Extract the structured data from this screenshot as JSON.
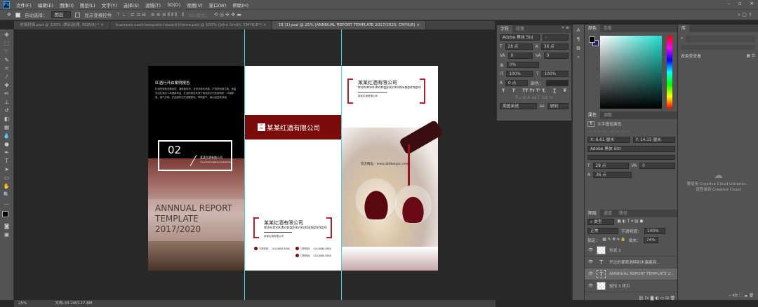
{
  "menu": [
    "文件(F)",
    "编辑(E)",
    "图像(I)",
    "图层(L)",
    "文字(Y)",
    "选择(S)",
    "滤镜(T)",
    "3D(D)",
    "视图(V)",
    "窗口(W)",
    "帮助(H)"
  ],
  "options": {
    "auto_select": "自动选择：",
    "layer_select": "图层",
    "show_transform": "显示变换控件",
    "mode_3d": "3D 模式："
  },
  "tabs": [
    "老猫封面.psd @ 100% (数码处理, RGB/8) *",
    "business-card-template-hazard-theme.psd @ 100% (John Smith, CMYK/8*)",
    "18 (1).psd @ 25% (ANNNUAL  REPORT TEMPLATE 2017/2020, CMYK/8)"
  ],
  "doc": {
    "p1_heading": "红酒行开启案例报告",
    "p1_body": "红酒是葡萄发酵而成，酒精度较低，含有多种有机酸、矿物质和维生素。适量饮用红酒对人体健康有益。红酒的颜色来源于葡萄皮中的色素物质，口感醇厚，香气浓郁。在品酒时应先观察颜色，再闻香气，最后品尝其味道。",
    "p1_number": "02",
    "p1_box_small": "某某红酒有限公司",
    "p1_box_pinyin": "moumouhongjiuyouxiangongsi",
    "p1_title": "ANNNUAL  REPORT TEMPLATE 2017/2020",
    "logo_top": "LO",
    "logo_bottom": "GO",
    "company": "某某红酒有限公司",
    "pinyin": "moumouhongjiuyouxiangongsi",
    "company_small": "某某红酒有限公司",
    "hotline_label": "订购热线：",
    "hotlines": [
      "020-8888 8888",
      "020-8888 8888",
      "020-8888 8888"
    ],
    "website": "官方网址：www.dbfheiqnc.com"
  },
  "character": {
    "tabs": [
      "字符",
      "段落"
    ],
    "font": "Adobe 黑体 Std",
    "style": "-",
    "size": "28 点",
    "leading": "36 点",
    "kerning": "0",
    "tracking": "0",
    "scale_v": "0%",
    "vscale": "100%",
    "hscale": "100%",
    "baseline": "0 点",
    "color_label": "颜色：",
    "language": "美国英语",
    "aa": "锐利"
  },
  "color": {
    "tabs": [
      "颜色",
      "色板"
    ],
    "accent": "#1fe0d0"
  },
  "properties": {
    "tabs": [
      "属性",
      "调整"
    ],
    "type_label": "文字图层属性",
    "x": "X: 6.61 厘米",
    "y": "Y: 14.15 厘米",
    "font": "Adobe 黑体 Std",
    "size": "28 点",
    "tracking": "0",
    "leading": "36 点"
  },
  "layers": {
    "tabs": [
      "图层",
      "通道",
      "路径"
    ],
    "filter": "类型",
    "blend": "正常",
    "opacity_label": "不透明度：",
    "opacity": "100%",
    "lock_label": "锁定：",
    "fill_label": "填充：",
    "fill": "74%",
    "items": [
      {
        "name": "形状 2",
        "type": "shape"
      },
      {
        "name": "开过的葡萄酒特别木塞塞回...",
        "type": "text"
      },
      {
        "name": "ANNNUAL  REPORT TEMPLATE 2...",
        "type": "text"
      },
      {
        "name": "矩形 3 拷贝",
        "type": "shape"
      }
    ]
  },
  "library": {
    "tab": "库",
    "view": "按类型查看",
    "cc_line1": "要使用 Creative Cloud Libraries，",
    "cc_line2": "请登录到 Creative Cloud",
    "size": "-- KB"
  },
  "status": {
    "zoom": "25%",
    "doc": "文档:33.2M/127.8M"
  }
}
